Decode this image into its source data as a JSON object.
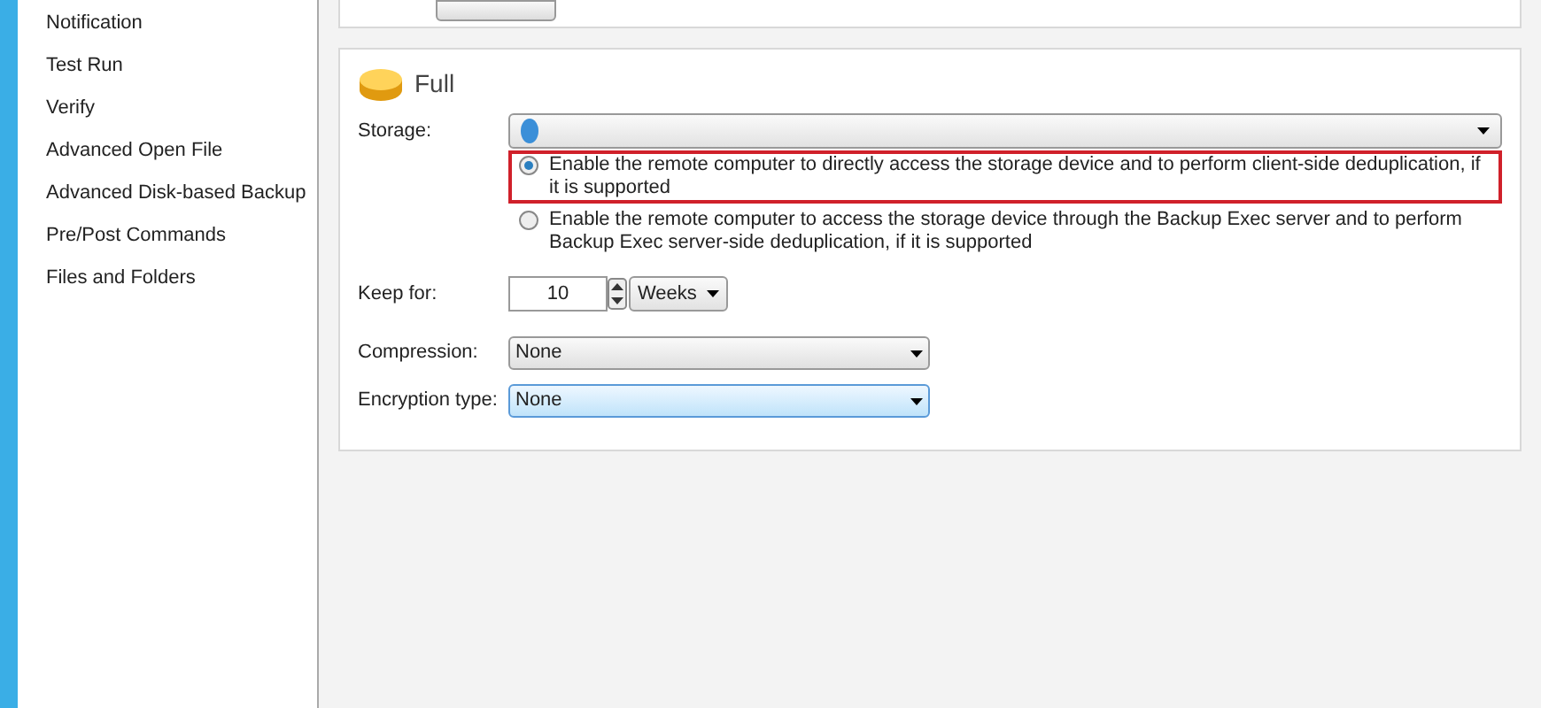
{
  "sidebar": {
    "items": [
      {
        "label": "Notification",
        "selected": false
      },
      {
        "label": "Test Run",
        "selected": false
      },
      {
        "label": "Verify",
        "selected": false
      },
      {
        "label": "Advanced Open File",
        "selected": false
      },
      {
        "label": "Advanced Disk-based Backup",
        "selected": false
      },
      {
        "label": "Pre/Post Commands",
        "selected": false
      },
      {
        "label": "Files and Folders",
        "selected": false
      }
    ]
  },
  "section": {
    "title": "Full",
    "storage": {
      "label": "Storage:"
    },
    "options": [
      {
        "label": "Enable the remote computer to directly access the storage device and to perform client-side deduplication, if it is supported",
        "selected": true,
        "highlighted": true
      },
      {
        "label": "Enable the remote computer to access the storage device through the Backup Exec server and to perform Backup Exec server-side deduplication, if it is supported",
        "selected": false,
        "highlighted": false
      }
    ],
    "keep_for": {
      "label": "Keep for:",
      "value": "10",
      "unit": "Weeks"
    },
    "fields": [
      {
        "label": "Compression:",
        "value": "None",
        "focused": false
      },
      {
        "label": "Encryption type:",
        "value": "None",
        "focused": true
      }
    ]
  }
}
